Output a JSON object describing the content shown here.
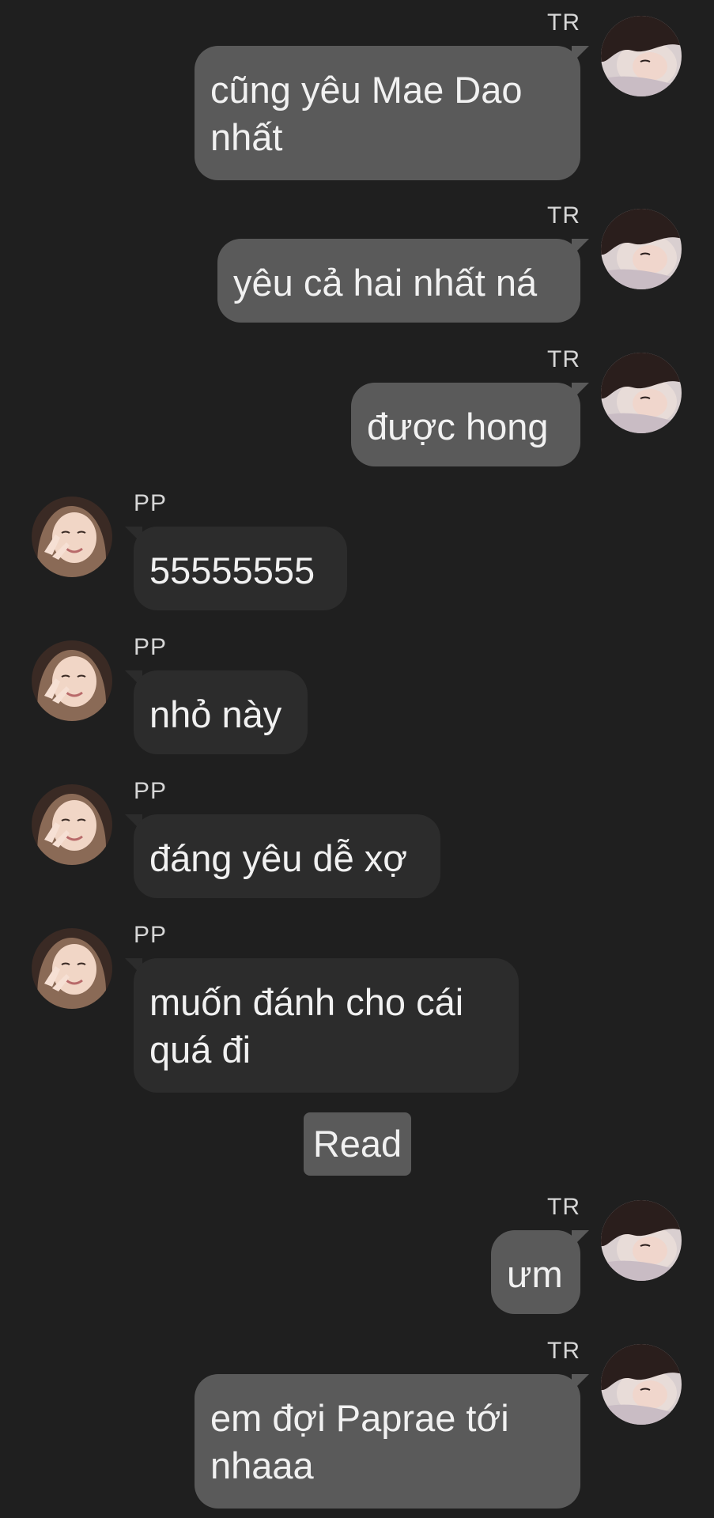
{
  "messages": [
    {
      "direction": "out",
      "sender": "TR",
      "text": "cũng yêu Mae Dao nhất",
      "lines": [
        "cũng yêu Mae Dao",
        "nhất"
      ]
    },
    {
      "direction": "out",
      "sender": "TR",
      "text": "yêu cả hai nhất ná"
    },
    {
      "direction": "out",
      "sender": "TR",
      "text": "được hong"
    },
    {
      "direction": "in",
      "sender": "PP",
      "text": "55555555"
    },
    {
      "direction": "in",
      "sender": "PP",
      "text": "nhỏ này"
    },
    {
      "direction": "in",
      "sender": "PP",
      "text": "đáng yêu dễ xợ"
    },
    {
      "direction": "in",
      "sender": "PP",
      "text": "muốn đánh cho cái quá đi",
      "lines": [
        "muốn đánh cho cái",
        "quá đi"
      ]
    },
    {
      "direction": "out",
      "sender": "TR",
      "text": "ưm"
    },
    {
      "direction": "out",
      "sender": "TR",
      "text": "em đợi Paprae tới nhaaa",
      "lines": [
        "em đợi Paprae tới",
        "nhaaa"
      ]
    }
  ],
  "read_status": "Read",
  "avatars": {
    "TR": "avatar-photo-TR",
    "PP": "avatar-photo-PP"
  },
  "colors": {
    "background": "#1f1f1f",
    "outgoing_bubble": "#5a5a5a",
    "incoming_bubble": "#2c2c2c",
    "text": "#f1f1f1",
    "name_text": "#d6d6d6"
  }
}
